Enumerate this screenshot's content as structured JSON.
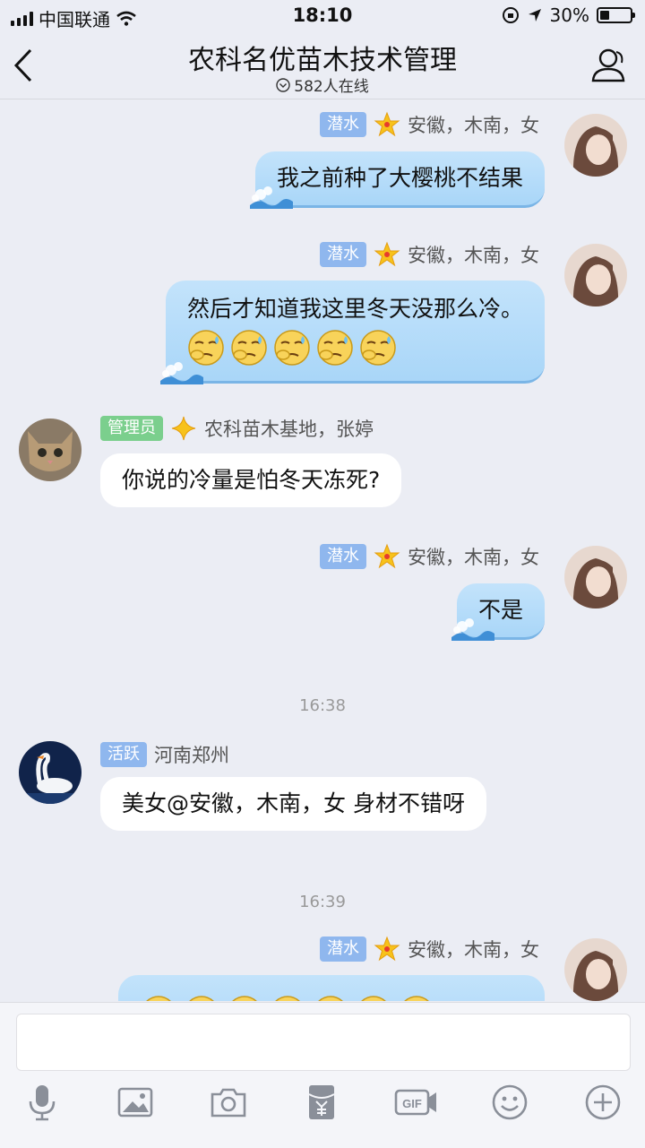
{
  "status_bar": {
    "carrier": "中国联通",
    "time": "18:10",
    "battery": "30%",
    "battery_level": 0.3
  },
  "header": {
    "title": "农科名优苗木技术管理",
    "online": "582人在线"
  },
  "messages": [
    {
      "tag": "潜水",
      "name": "安徽，木南，女",
      "text": "我之前种了大樱桃不结果"
    },
    {
      "tag": "潜水",
      "name": "安徽，木南，女",
      "text": "然后才知道我这里冬天没那么冷。",
      "emoji_count": 5
    },
    {
      "tag": "管理员",
      "name": "农科苗木基地，张婷",
      "text": "你说的冷量是怕冬天冻死?"
    },
    {
      "tag": "潜水",
      "name": "安徽，木南，女",
      "text": "不是"
    },
    {
      "time": "16:38"
    },
    {
      "tag": "活跃",
      "name": "河南郑州",
      "text": "美女@安徽，木南，女 身材不错呀"
    },
    {
      "time": "16:39"
    },
    {
      "tag": "潜水",
      "name": "安徽，木南，女",
      "emoji_count": 7
    }
  ],
  "toolbar": {
    "icons": [
      "microphone-icon",
      "image-icon",
      "camera-icon",
      "red-packet-icon",
      "gif-icon",
      "smiley-icon",
      "plus-icon"
    ]
  }
}
